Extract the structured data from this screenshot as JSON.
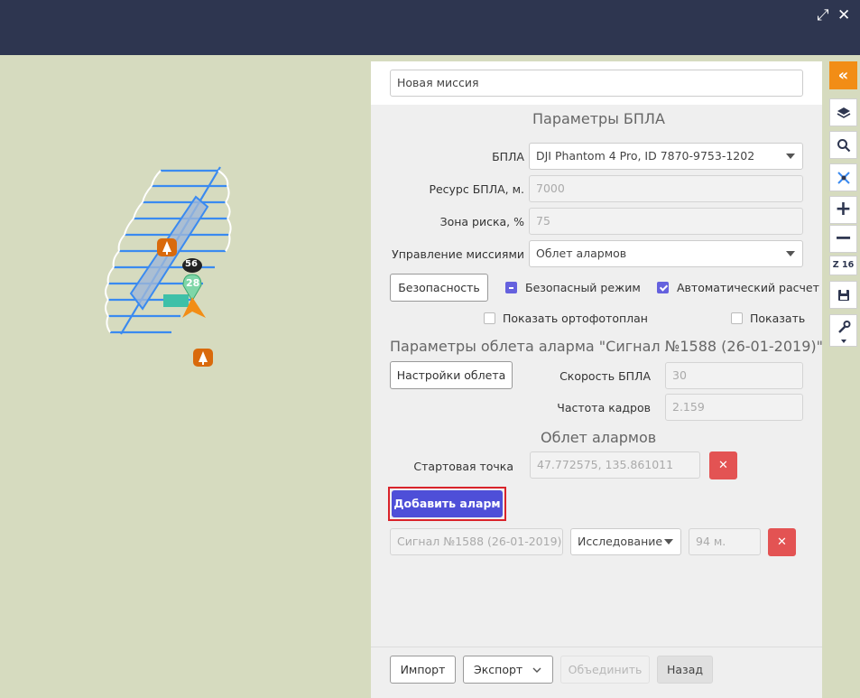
{
  "header": {
    "expand_glyph": "⤢",
    "close_glyph": "✕"
  },
  "map": {
    "markers": {
      "badge_56": "56",
      "badge_28": "28"
    }
  },
  "mission": {
    "name": "Новая миссия"
  },
  "uav_params": {
    "title": "Параметры БПЛА",
    "uav_label": "БПЛА",
    "uav_value": "DJI Phantom 4 Pro, ID 7870-9753-1202",
    "resource_label": "Ресурс БПЛА, м.",
    "resource_placeholder": "7000",
    "risk_label": "Зона риска, %",
    "risk_placeholder": "75",
    "control_label": "Управление миссиями",
    "control_value": "Облет алармов",
    "safety_button": "Безопасность",
    "safe_mode_label": "Безопасный режим",
    "auto_calc_label": "Автоматический расчет",
    "ortho_label": "Показать ортофотоплан",
    "show_label": "Показать"
  },
  "alarm_flight": {
    "title": "Параметры облета аларма  \"Сигнал №1588 (26-01-2019)\"",
    "settings_button": "Настройки облета",
    "speed_label": "Скорость БПЛА",
    "speed_placeholder": "30",
    "fps_label": "Частота кадров",
    "fps_placeholder": "2.159"
  },
  "alarms": {
    "title": "Облет алармов",
    "start_label": "Стартовая точка",
    "start_value": "47.772575, 135.861011",
    "add_button": "Добавить аларм",
    "row": {
      "signal": "Сигнал №1588 (26-01-2019)",
      "mode": "Исследование",
      "distance": "94 м."
    },
    "delete_glyph": "✕"
  },
  "footer": {
    "import": "Импорт",
    "export": "Экспорт",
    "merge": "Объединить",
    "back": "Назад"
  },
  "toolbar": {
    "zoom_label": "Z 16"
  },
  "colors": {
    "accent": "#4e4fd8",
    "danger": "#e35353",
    "toolbar_orange": "#f28d16",
    "header": "#2e3650",
    "route": "#3a8af0"
  }
}
